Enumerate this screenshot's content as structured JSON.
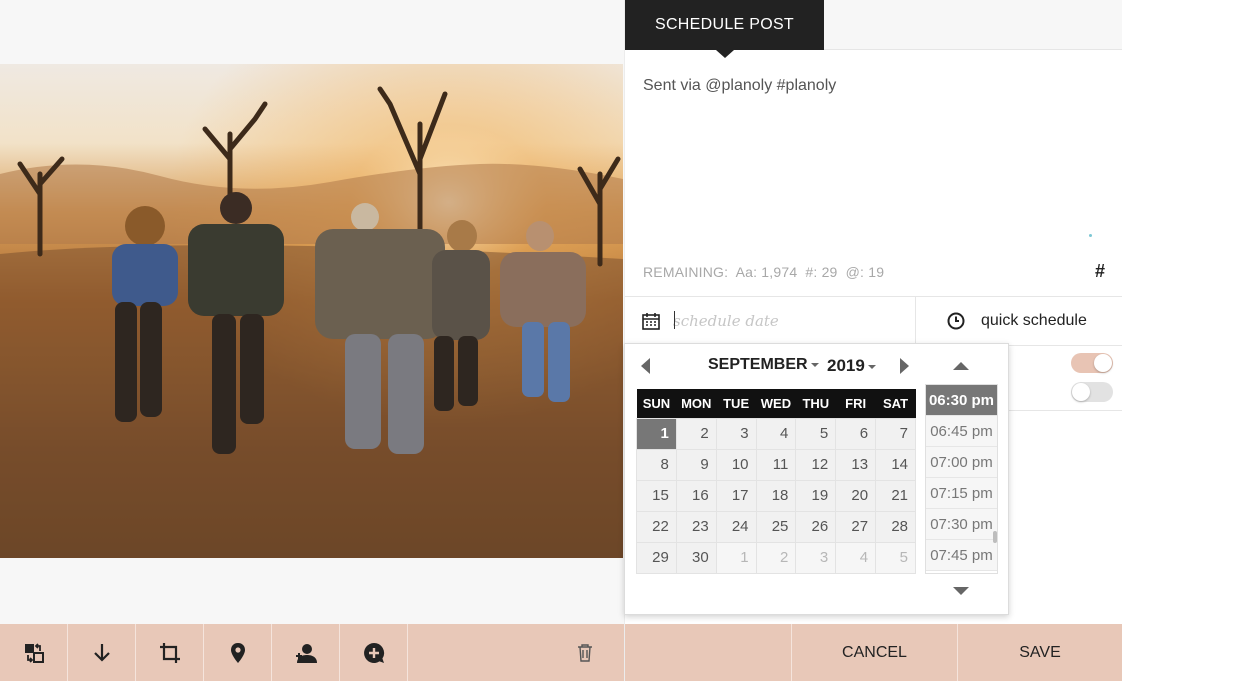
{
  "window": {
    "active_tab": "SCHEDULE POST"
  },
  "post": {
    "caption": "Sent via @planoly #planoly",
    "remaining_label": "REMAINING:",
    "remaining_chars": "Aa: 1,974",
    "remaining_hashtags": "#: 29",
    "remaining_mentions": "@: 19",
    "hashtag_button": "#"
  },
  "schedule": {
    "date_placeholder": "schedule date",
    "quick_schedule_label": "quick schedule",
    "toggles": [
      {
        "state": "on"
      },
      {
        "state": "off"
      }
    ]
  },
  "datepicker": {
    "month": "SEPTEMBER",
    "year": "2019",
    "weekdays": [
      "SUN",
      "MON",
      "TUE",
      "WED",
      "THU",
      "FRI",
      "SAT"
    ],
    "weeks": [
      [
        "1",
        "2",
        "3",
        "4",
        "5",
        "6",
        "7"
      ],
      [
        "8",
        "9",
        "10",
        "11",
        "12",
        "13",
        "14"
      ],
      [
        "15",
        "16",
        "17",
        "18",
        "19",
        "20",
        "21"
      ],
      [
        "22",
        "23",
        "24",
        "25",
        "26",
        "27",
        "28"
      ],
      [
        "29",
        "30",
        "1",
        "2",
        "3",
        "4",
        "5"
      ]
    ],
    "selected_day": "1",
    "times": [
      "06:30 pm",
      "06:45 pm",
      "07:00 pm",
      "07:15 pm",
      "07:30 pm",
      "07:45 pm"
    ],
    "selected_time": "06:30 pm"
  },
  "media_toolbar": {
    "icons": [
      "swap-icon",
      "download-icon",
      "crop-icon",
      "location-pin-icon",
      "tag-user-icon",
      "add-comment-icon",
      "trash-icon"
    ]
  },
  "actions": {
    "cancel": "CANCEL",
    "save": "SAVE"
  },
  "colors": {
    "accent": "#e8c8b8",
    "dark": "#222222",
    "selected": "#777777",
    "toggle_on": "#e8c4b4"
  }
}
